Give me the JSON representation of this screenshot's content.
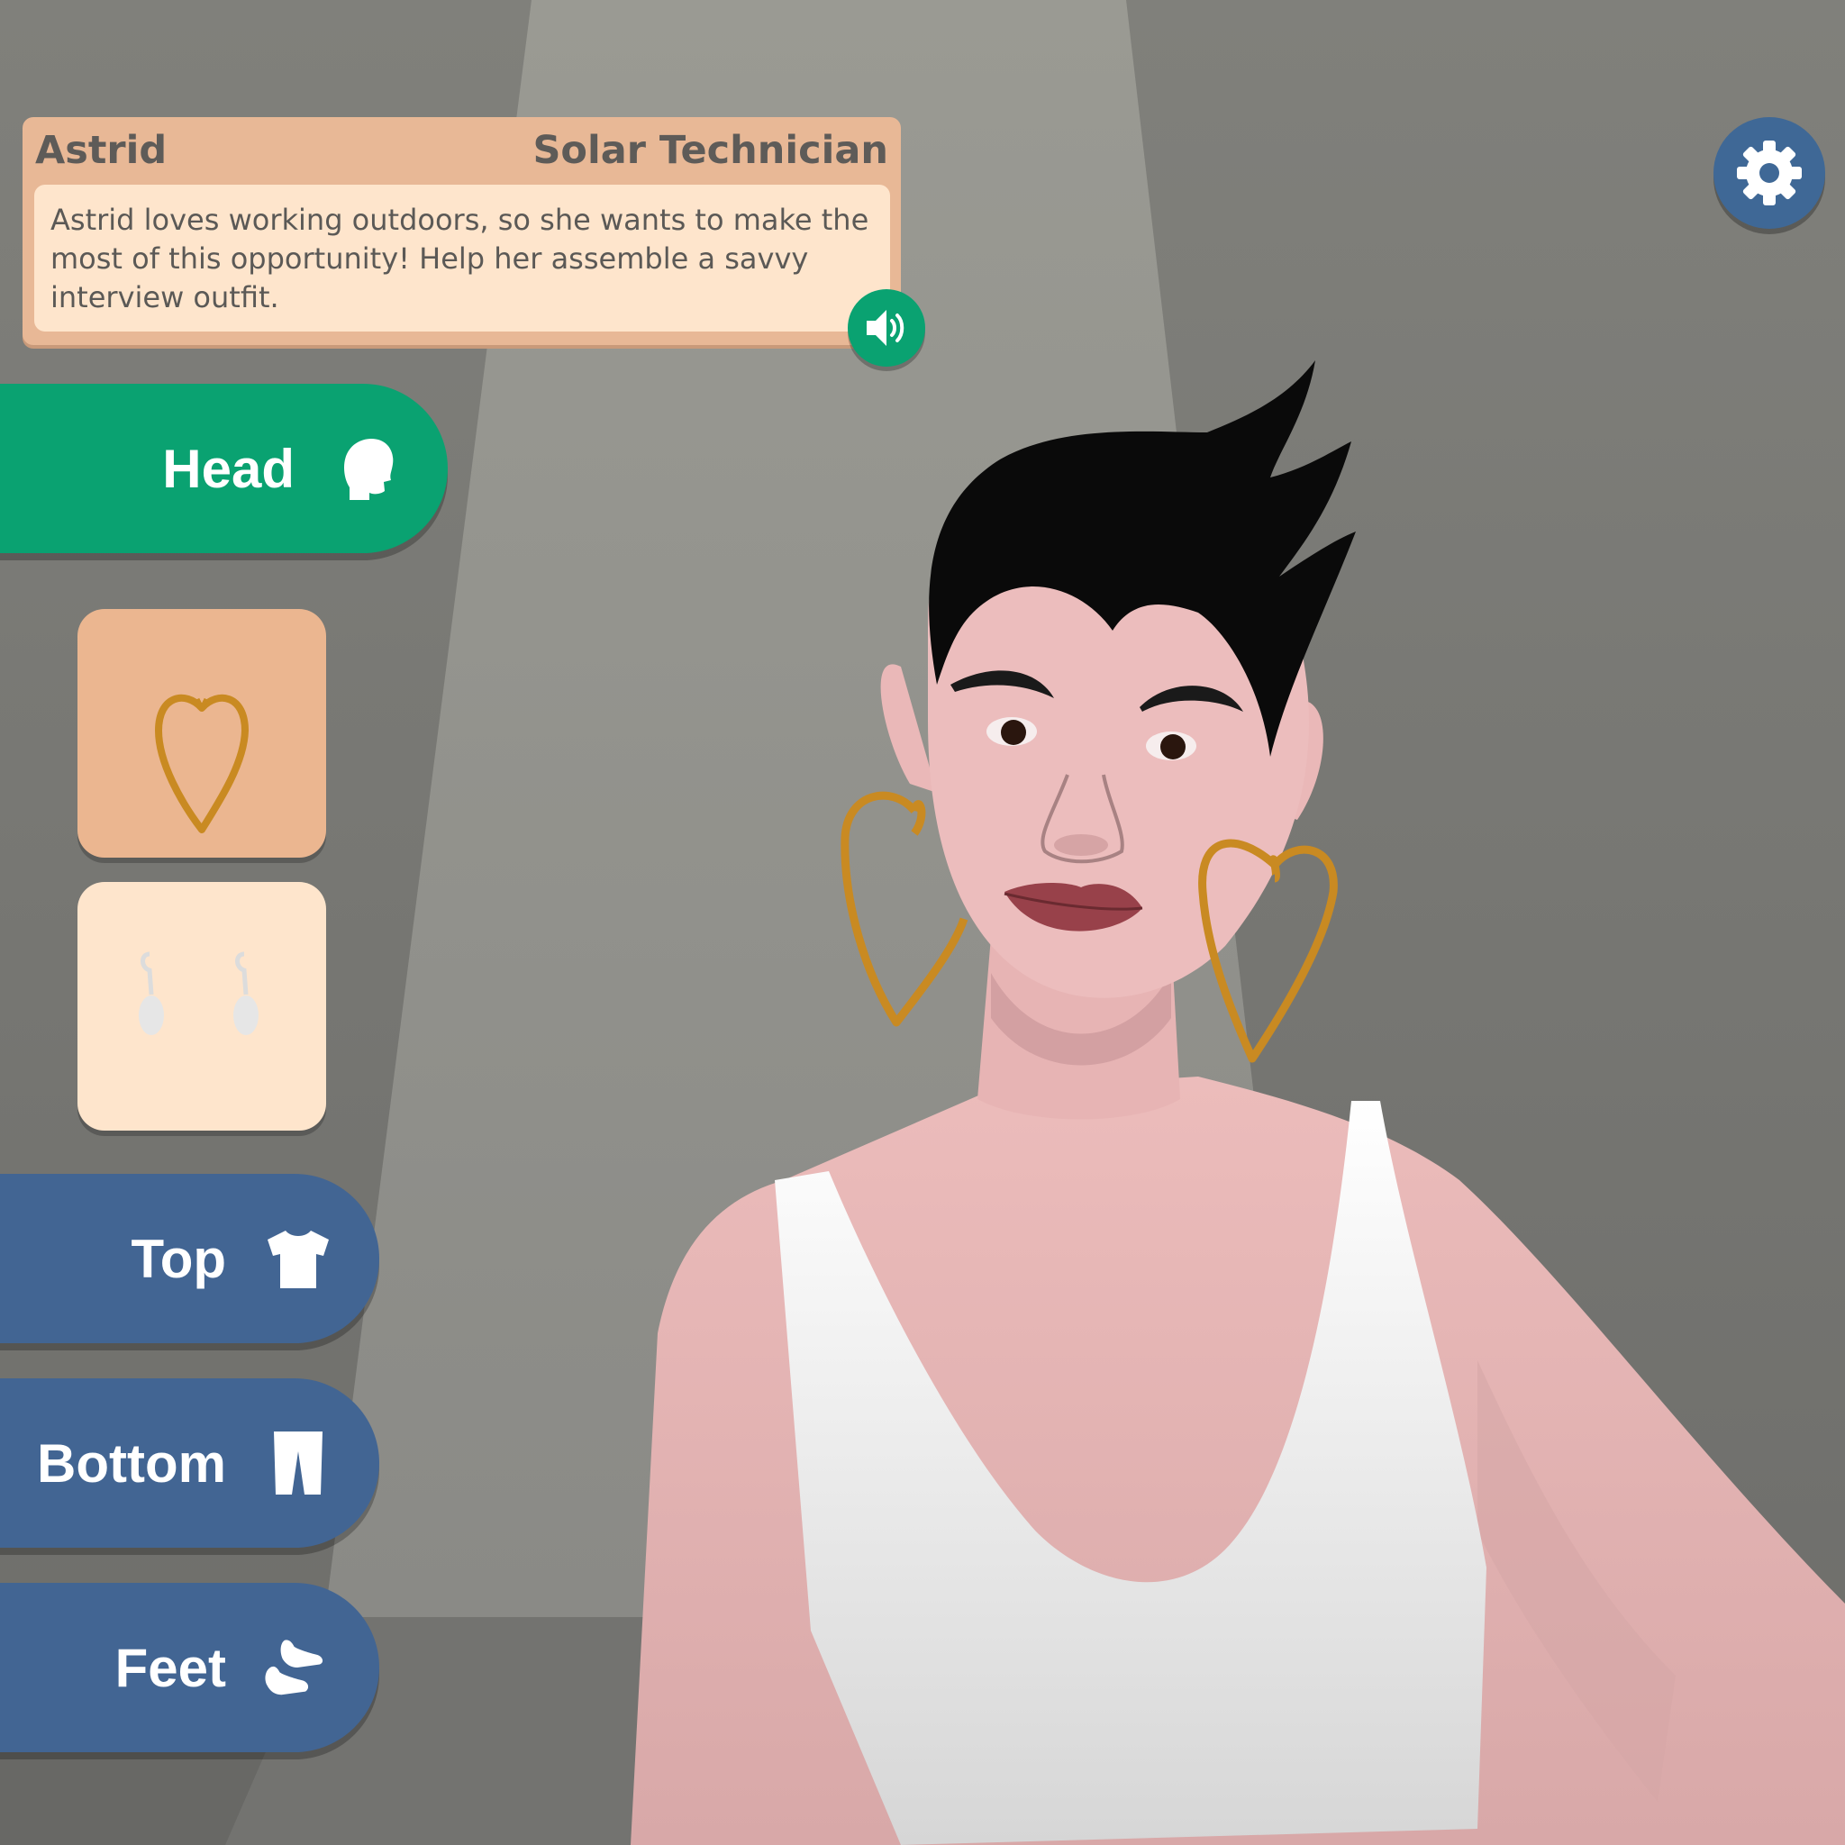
{
  "character": {
    "name": "Astrid",
    "job": "Solar Technician",
    "description": "Astrid loves working outdoors, so she wants to make the most of this opportunity! Help her assemble a savvy interview outfit."
  },
  "controls": {
    "speaker_icon": "speaker-icon",
    "settings_icon": "gear-icon"
  },
  "categories": [
    {
      "label": "Head",
      "icon": "head-icon",
      "active": true
    },
    {
      "label": "Top",
      "icon": "shirt-icon",
      "active": false
    },
    {
      "label": "Bottom",
      "icon": "pants-icon",
      "active": false
    },
    {
      "label": "Feet",
      "icon": "shoes-icon",
      "active": false
    }
  ],
  "items": [
    {
      "name": "gold heart hoop earrings",
      "selected": true
    },
    {
      "name": "silver drop earrings",
      "selected": false
    }
  ],
  "colors": {
    "accent_green": "#0aa271",
    "tab_blue": "#426593",
    "card_tan": "#e8b896",
    "card_cream": "#fee5cc",
    "earring_gold": "#c98a22"
  }
}
